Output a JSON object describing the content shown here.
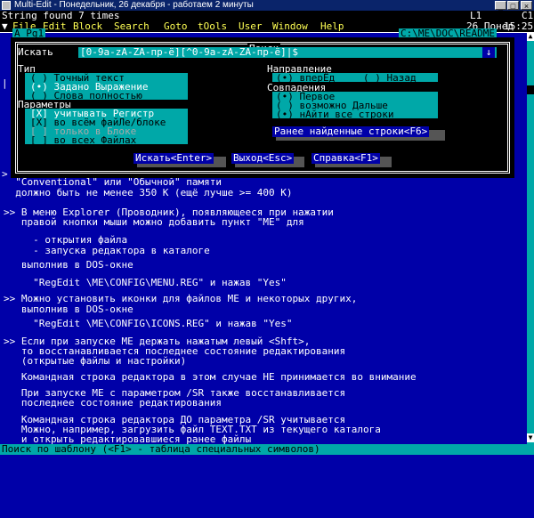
{
  "window": {
    "title": "Multi-Edit - Понедельник, 26 декабря - работаем 2 минуты",
    "buttons": [
      "_",
      "□",
      "×"
    ]
  },
  "info_line": {
    "message": "String found 7 times",
    "line": "L1",
    "col": "C1",
    "date": "26 Понед",
    "time": "15:25"
  },
  "menu": {
    "items": [
      "File",
      "Edit",
      "Block",
      "Search",
      "Goto",
      "tOols",
      "User",
      "Window",
      "Help"
    ]
  },
  "tabs": {
    "left": "A Pg1",
    "right": "C:\\ME\\DOC\\README"
  },
  "dialog": {
    "title": "Поиск",
    "search_label": "Искать",
    "search_value": "[0-9a-zA-ZА-пр-ё][^0-9a-zA-ZА-пр-ё]|$",
    "type_label": "Тип",
    "type_options": [
      "( ) Точный текст",
      "(•) Задано Выражение",
      "( ) Слова полностью"
    ],
    "params_label": "Параметры",
    "params_options": [
      "[X] учитывать Регистр",
      "[X] во всём файЛе/блоке",
      "[ ] только в Блоке",
      "[ ] во всех Файлах"
    ],
    "direction_label": "Направление",
    "direction_options": [
      "(•) вперЁд",
      "( ) Назад"
    ],
    "match_label": "Совпадения",
    "match_options": [
      "(•) Первое",
      "( ) возможно Дальше",
      "(•) нАйти все строки"
    ],
    "history_button": "Ранее найденные строки<F6>",
    "find_button": "Искать<Enter>",
    "exit_button": "Выход<Esc>",
    "help_button": "Справка<F1>"
  },
  "editor_lines": [
    "  \"Conventional\" или \"Обычной\" памяти",
    "  должно быть не менее 350 K (ещё лучше >= 400 K)",
    "",
    ">> В меню Explorer (Проводник), появляющееся при нажатии",
    "   правой кнопки мыши можно добавить пункт \"ME\" для",
    "",
    "     - открытия файла",
    "     - запуска редактора в каталоге",
    "",
    "   выполнив в DOS-окне",
    "",
    "     \"RegEdit \\ME\\CONFIG\\MENU.REG\" и нажав \"Yes\"",
    "",
    ">> Можно установить иконки для файлов ME и некоторых других,",
    "   выполнив в DOS-окне",
    "",
    "     \"RegEdit \\ME\\CONFIG\\ICONS.REG\" и нажав \"Yes\"",
    "",
    ">> Если при запуске ME держать нажатым левый <Shft>,",
    "   то восстанавливается последнее состояние редактирования",
    "   (открытые файлы и настройки)",
    "",
    "   Командная строка редактора в этом случае НЕ принимается во внимание",
    "",
    "   При запуске ME с параметром /SR также восстанавливается",
    "   последнее состояние редактирования",
    "",
    "   Командная строка редактора ДО параметра /SR учитывается",
    "   Можно, например, загрузить файл TEXT.TXT из текущего каталога",
    "   и открыть редактировавшиеся ранее файлы"
  ],
  "status": "Поиск по шаблону (<F1> - таблица специальных символов)"
}
